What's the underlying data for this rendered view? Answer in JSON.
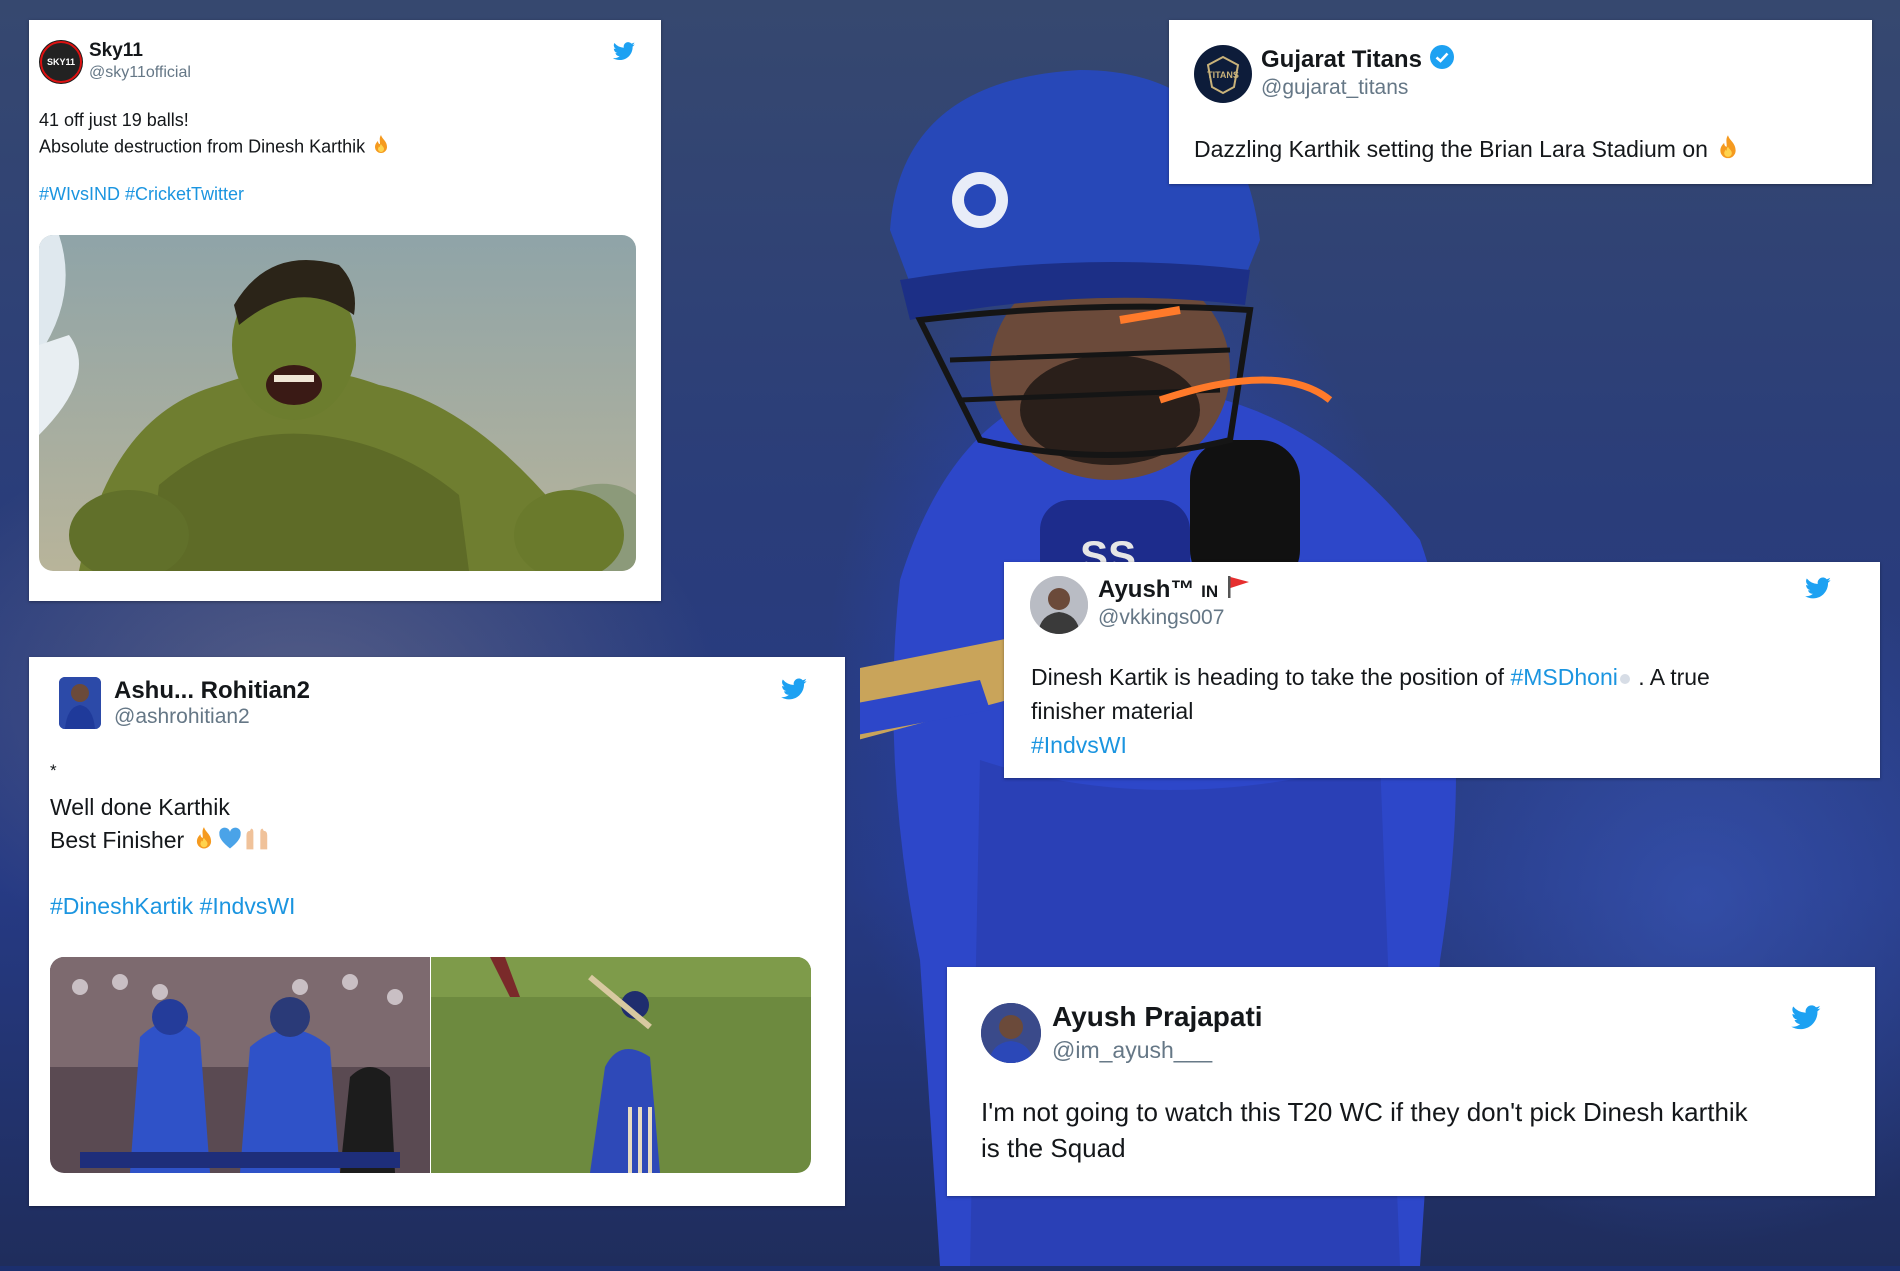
{
  "tweets": {
    "sky11": {
      "name": "Sky11",
      "handle": "@sky11official",
      "avatar_text": "SKY11",
      "line1": "41 off just 19 balls!",
      "line2": "Absolute destruction from Dinesh Karthik",
      "hashtags": "#WIvsIND #CricketTwitter",
      "media": "hulk-image"
    },
    "gujarat": {
      "name": "Gujarat Titans",
      "handle": "@gujarat_titans",
      "avatar_text": "TITANS",
      "verified": true,
      "line1": "Dazzling Karthik setting the Brian Lara Stadium on"
    },
    "ashu": {
      "name": "Ashu... Rohitian2",
      "handle": "@ashrohitian2",
      "line0": "*",
      "line1": "Well done Karthik",
      "line2": "Best Finisher",
      "hashtags": "#DineshKartik #IndvsWI",
      "media": "match-stills"
    },
    "ayush_vk": {
      "name": "Ayush™",
      "flag_prefix": "IN",
      "handle": "@vkkings007",
      "line1_a": "Dinesh Kartik is heading to take the position of",
      "line1_tag": "#MSDhoni",
      "line1_b": ". A true",
      "line2": "finisher material",
      "hashtag": "#IndvsWI"
    },
    "ayush_p": {
      "name": "Ayush Prajapati",
      "handle": "@im_ayush___",
      "line1": "I'm not going to watch this T20 WC if they don't pick Dinesh karthik",
      "line2": "is the Squad"
    }
  },
  "icons": {
    "twitter": "twitter-bird-icon",
    "verified": "verified-badge-icon",
    "fire": "fire-emoji",
    "heart": "blue-heart-emoji",
    "hands": "raising-hands-emoji",
    "flag": "red-flag-emoji"
  },
  "colors": {
    "twitter_blue": "#1da1f2",
    "hashtag": "#1b95e0",
    "jersey_blue": "#2b4bd6"
  }
}
